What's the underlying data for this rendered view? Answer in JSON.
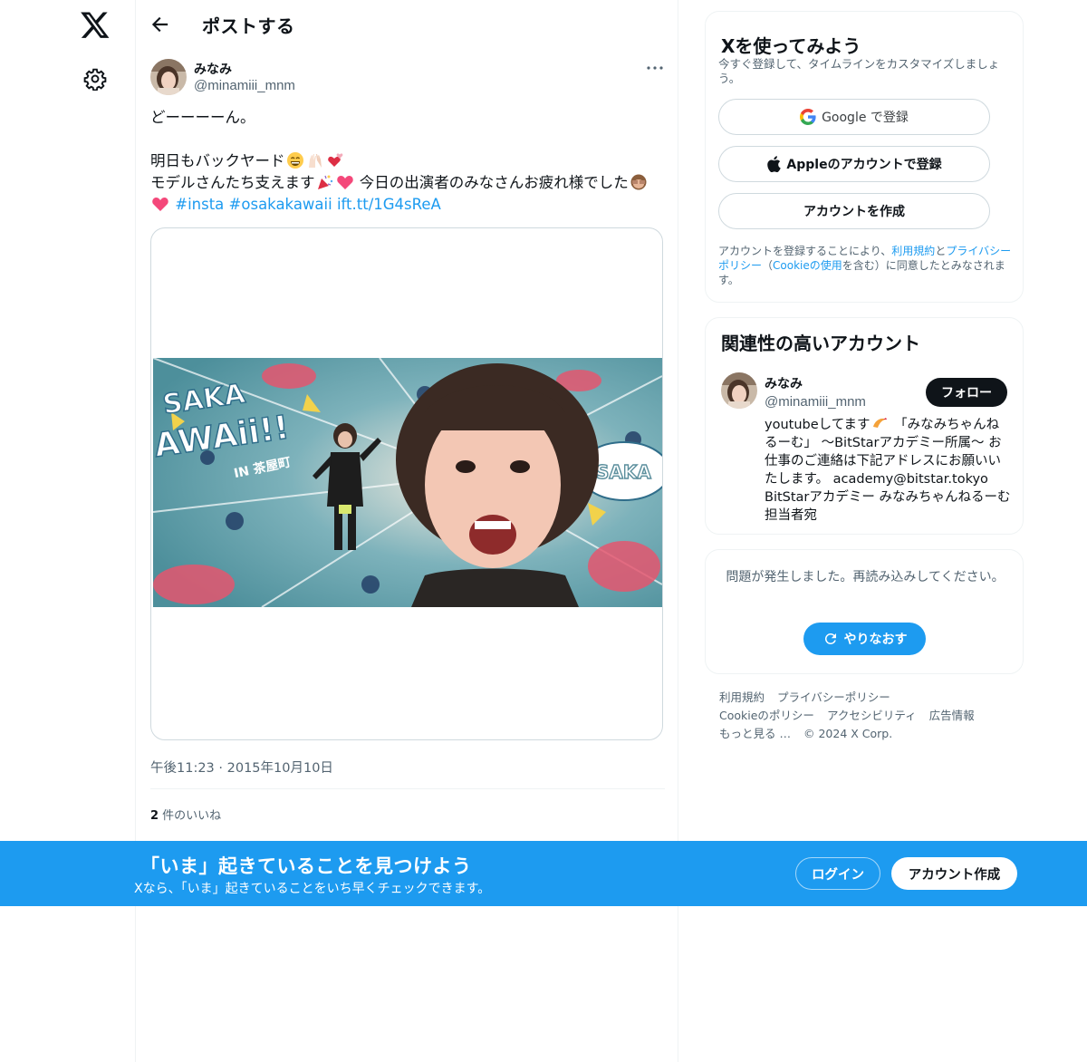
{
  "nav": {
    "logo_icon": "x-logo-icon",
    "settings_icon": "gear-icon"
  },
  "header": {
    "title": "ポストする",
    "back_icon": "arrow-left-icon"
  },
  "post": {
    "author_name": "みなみ",
    "author_handle": "@minamiii_mnm",
    "text_line1": "どーーーーん。",
    "text_line2": "明日もバックヤード",
    "text_line3_a": "モデルさんたち支えます",
    "text_line3_b": " 今日の出演者のみなさんお疲れ様でした",
    "hashtag1": "#insta",
    "hashtag2": "#osakakawaii",
    "short_link": "ift.tt/1G4sReA",
    "timestamp": "午後11:23 · 2015年10月10日",
    "likes_count": "2",
    "likes_label": " 件のいいね"
  },
  "signup": {
    "title": "Xを使ってみよう",
    "subtitle": "今すぐ登録して、タイムラインをカスタマイズしましょう。",
    "google_label_a": "Google",
    "google_label_b": " で登録",
    "apple_label": "Appleのアカウントで登録",
    "create_label": "アカウントを作成",
    "legal_a": "アカウントを登録することにより、",
    "legal_terms": "利用規約",
    "legal_and": "と",
    "legal_privacy": "プライバシーポリシー",
    "legal_b": "（",
    "legal_cookie": "Cookieの使用",
    "legal_c": "を含む）に同意したとみなされます。"
  },
  "related": {
    "title": "関連性の高いアカウント",
    "name": "みなみ",
    "handle": "@minamiii_mnm",
    "follow_label": "フォロー",
    "bio_a": "youtubeしてます",
    "bio_b": " 「みなみちゃんねるーむ」 〜BitStarアカデミー所属〜 お仕事のご連絡は下記アドレスにお願いいたします。 academy@bitstar.tokyo BitStarアカデミー みなみちゃんねるーむ担当者宛"
  },
  "error": {
    "message": "問題が発生しました。再読み込みしてください。",
    "retry_label": "やりなおす"
  },
  "footer": {
    "links": [
      "利用規約",
      "プライバシーポリシー",
      "Cookieのポリシー",
      "アクセシビリティ",
      "広告情報",
      "もっと見る …",
      "© 2024 X Corp."
    ]
  },
  "banner": {
    "title": "「いま」起きていることを見つけよう",
    "subtitle": "Xなら、「いま」起きていることをいち早くチェックできます。",
    "login_label": "ログイン",
    "signup_label": "アカウント作成"
  },
  "media": {
    "sign_text_left": "SAKA",
    "sign_text_big": "AWAii!!",
    "sign_text_sub": "IN 茶屋町",
    "sign_text_right": "OSAKA"
  },
  "colors": {
    "accent": "#1d9bf0",
    "text": "#0f1419",
    "muted": "#536471",
    "border": "#eff3f4"
  }
}
